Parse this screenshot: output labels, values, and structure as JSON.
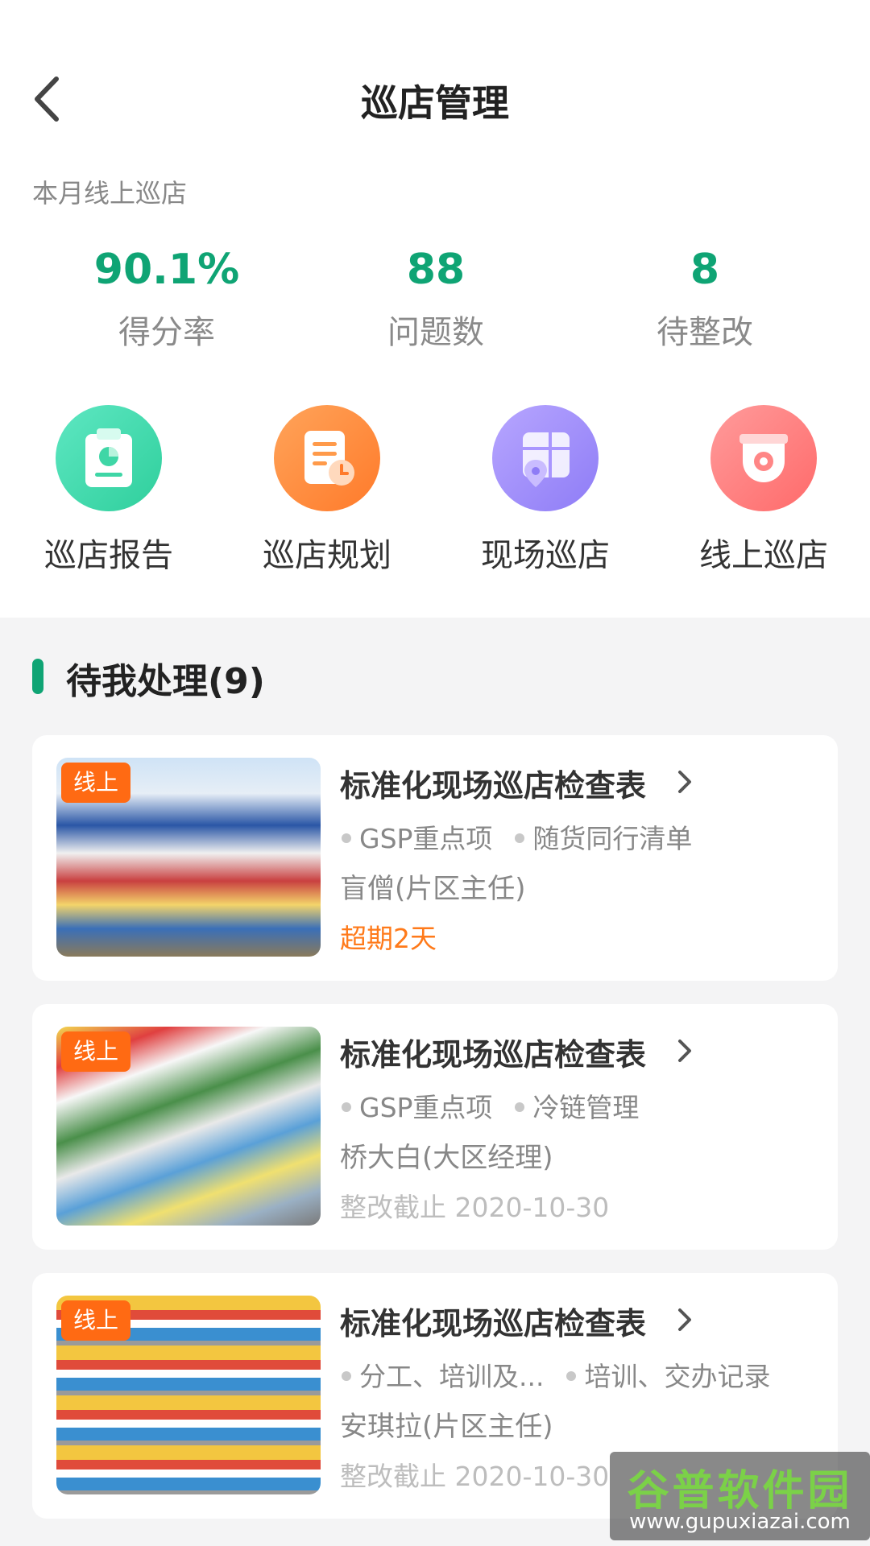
{
  "header": {
    "title": "巡店管理"
  },
  "month": {
    "label": "本月线上巡店",
    "stats": [
      {
        "value": "90.1%",
        "label": "得分率"
      },
      {
        "value": "88",
        "label": "问题数"
      },
      {
        "value": "8",
        "label": "待整改"
      }
    ]
  },
  "actions": [
    {
      "label": "巡店报告",
      "icon": "clipboard-chart-icon",
      "color": "#2fcf9c"
    },
    {
      "label": "巡店规划",
      "icon": "document-clock-icon",
      "color": "#ff7a2a"
    },
    {
      "label": "现场巡店",
      "icon": "map-location-icon",
      "color": "#8e7cf6"
    },
    {
      "label": "线上巡店",
      "icon": "security-camera-icon",
      "color": "#ff6a6a"
    }
  ],
  "pending": {
    "title": "待我处理(9)"
  },
  "tasks": [
    {
      "tag": "线上",
      "title": "标准化现场巡店检查表",
      "items": [
        "GSP重点项",
        "随货同行清单"
      ],
      "person": "盲僧(片区主任)",
      "status": "超期2天",
      "status_type": "overdue"
    },
    {
      "tag": "线上",
      "title": "标准化现场巡店检查表",
      "items": [
        "GSP重点项",
        "冷链管理"
      ],
      "person": "桥大白(大区经理)",
      "status": "整改截止 2020-10-30",
      "status_type": "deadline"
    },
    {
      "tag": "线上",
      "title": "标准化现场巡店检查表",
      "items": [
        "分工、培训及...",
        "培训、交办记录"
      ],
      "person": "安琪拉(片区主任)",
      "status": "整改截止 2020-10-30",
      "status_type": "deadline"
    }
  ],
  "watermark": {
    "brand": "谷普软件园",
    "url": "www.gupuxiazai.com"
  },
  "colors": {
    "accent": "#0fa474",
    "tag": "#ff6a13",
    "overdue": "#ff7a1a"
  }
}
